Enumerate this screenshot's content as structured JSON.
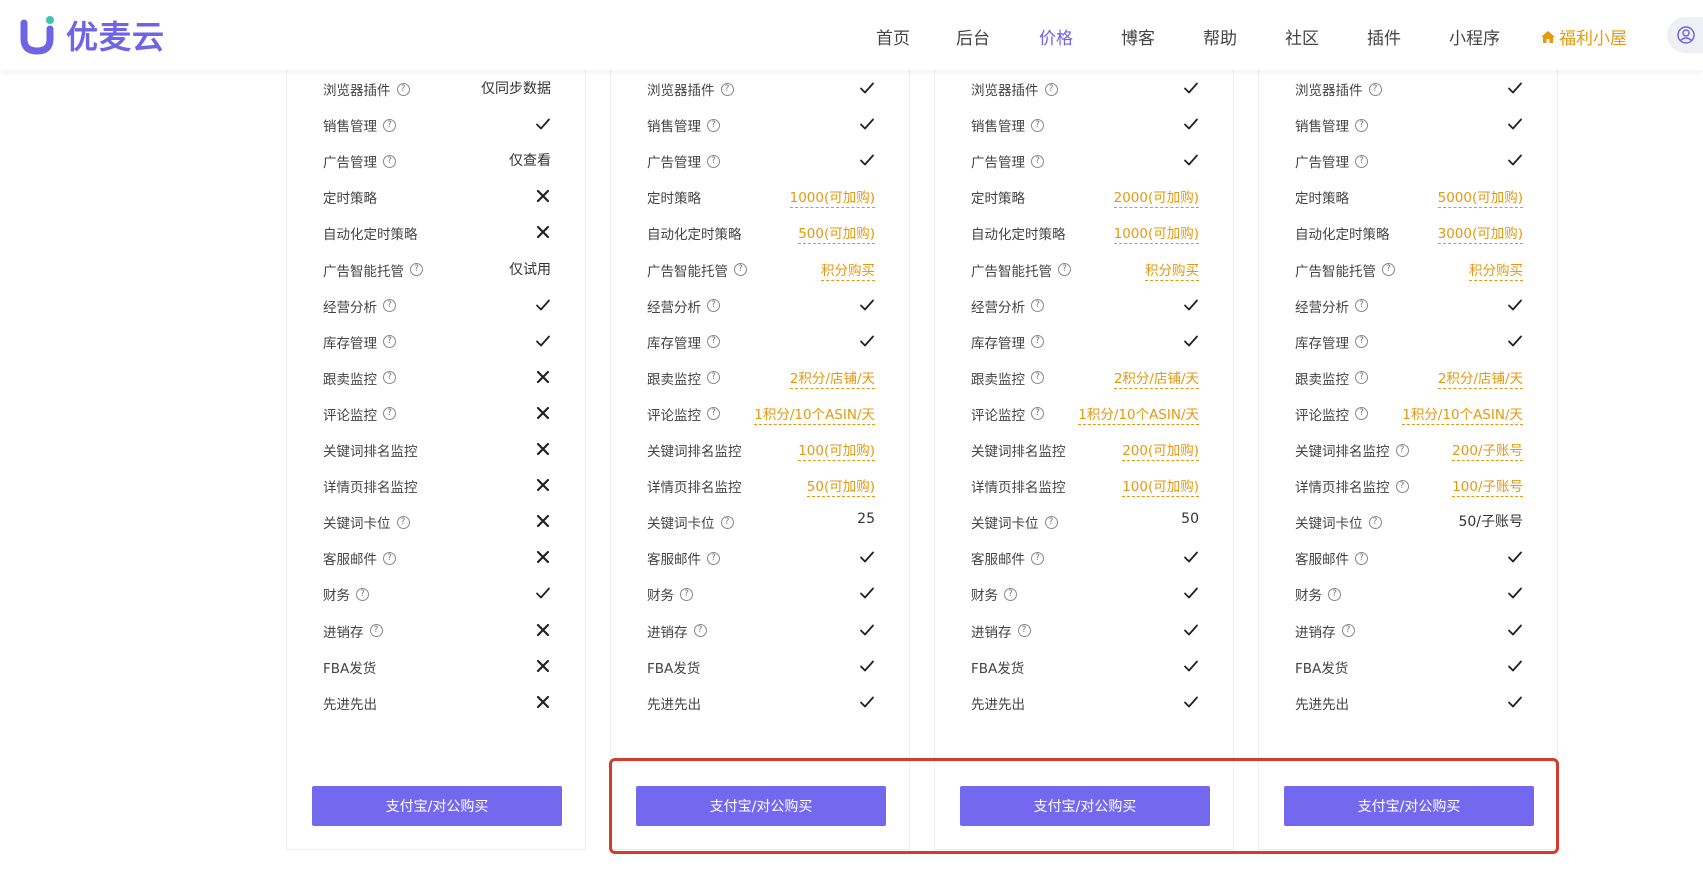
{
  "brand": {
    "name": "优麦云"
  },
  "nav": {
    "items": [
      "首页",
      "后台",
      "价格",
      "博客",
      "帮助",
      "社区",
      "插件",
      "小程序"
    ],
    "active_index": 2,
    "special": "福利小屋"
  },
  "colors": {
    "accent": "#7468ef",
    "orange": "#e39a10",
    "highlight": "#d23c2a"
  },
  "plans": [
    {
      "button": "支付宝/对公购买",
      "rows": [
        {
          "feature": "浏览器插件",
          "help": true,
          "kind": "text",
          "value": "仅同步数据"
        },
        {
          "feature": "销售管理",
          "help": true,
          "kind": "check"
        },
        {
          "feature": "广告管理",
          "help": true,
          "kind": "text",
          "value": "仅查看"
        },
        {
          "feature": "定时策略",
          "help": false,
          "kind": "cross"
        },
        {
          "feature": "自动化定时策略",
          "help": false,
          "kind": "cross"
        },
        {
          "feature": "广告智能托管",
          "help": true,
          "kind": "text",
          "value": "仅试用"
        },
        {
          "feature": "经营分析",
          "help": true,
          "kind": "check"
        },
        {
          "feature": "库存管理",
          "help": true,
          "kind": "check"
        },
        {
          "feature": "跟卖监控",
          "help": true,
          "kind": "cross"
        },
        {
          "feature": "评论监控",
          "help": true,
          "kind": "cross"
        },
        {
          "feature": "关键词排名监控",
          "help": false,
          "kind": "cross"
        },
        {
          "feature": "详情页排名监控",
          "help": false,
          "kind": "cross"
        },
        {
          "feature": "关键词卡位",
          "help": true,
          "kind": "cross"
        },
        {
          "feature": "客服邮件",
          "help": true,
          "kind": "cross"
        },
        {
          "feature": "财务",
          "help": true,
          "kind": "check"
        },
        {
          "feature": "进销存",
          "help": true,
          "kind": "cross"
        },
        {
          "feature": "FBA发货",
          "help": false,
          "kind": "cross"
        },
        {
          "feature": "先进先出",
          "help": false,
          "kind": "cross"
        }
      ]
    },
    {
      "button": "支付宝/对公购买",
      "rows": [
        {
          "feature": "浏览器插件",
          "help": true,
          "kind": "check"
        },
        {
          "feature": "销售管理",
          "help": true,
          "kind": "check"
        },
        {
          "feature": "广告管理",
          "help": true,
          "kind": "check"
        },
        {
          "feature": "定时策略",
          "help": false,
          "kind": "orange",
          "value": "1000(可加购)"
        },
        {
          "feature": "自动化定时策略",
          "help": false,
          "kind": "orange",
          "value": "500(可加购)"
        },
        {
          "feature": "广告智能托管",
          "help": true,
          "kind": "orange",
          "value": "积分购买"
        },
        {
          "feature": "经营分析",
          "help": true,
          "kind": "check"
        },
        {
          "feature": "库存管理",
          "help": true,
          "kind": "check"
        },
        {
          "feature": "跟卖监控",
          "help": true,
          "kind": "orange",
          "value": "2积分/店铺/天"
        },
        {
          "feature": "评论监控",
          "help": true,
          "kind": "orange",
          "value": "1积分/10个ASIN/天"
        },
        {
          "feature": "关键词排名监控",
          "help": false,
          "kind": "orange",
          "value": "100(可加购)"
        },
        {
          "feature": "详情页排名监控",
          "help": false,
          "kind": "orange",
          "value": "50(可加购)"
        },
        {
          "feature": "关键词卡位",
          "help": true,
          "kind": "text",
          "value": "25"
        },
        {
          "feature": "客服邮件",
          "help": true,
          "kind": "check"
        },
        {
          "feature": "财务",
          "help": true,
          "kind": "check"
        },
        {
          "feature": "进销存",
          "help": true,
          "kind": "check"
        },
        {
          "feature": "FBA发货",
          "help": false,
          "kind": "check"
        },
        {
          "feature": "先进先出",
          "help": false,
          "kind": "check"
        }
      ]
    },
    {
      "button": "支付宝/对公购买",
      "rows": [
        {
          "feature": "浏览器插件",
          "help": true,
          "kind": "check"
        },
        {
          "feature": "销售管理",
          "help": true,
          "kind": "check"
        },
        {
          "feature": "广告管理",
          "help": true,
          "kind": "check"
        },
        {
          "feature": "定时策略",
          "help": false,
          "kind": "orange",
          "value": "2000(可加购)"
        },
        {
          "feature": "自动化定时策略",
          "help": false,
          "kind": "orange",
          "value": "1000(可加购)"
        },
        {
          "feature": "广告智能托管",
          "help": true,
          "kind": "orange",
          "value": "积分购买"
        },
        {
          "feature": "经营分析",
          "help": true,
          "kind": "check"
        },
        {
          "feature": "库存管理",
          "help": true,
          "kind": "check"
        },
        {
          "feature": "跟卖监控",
          "help": true,
          "kind": "orange",
          "value": "2积分/店铺/天"
        },
        {
          "feature": "评论监控",
          "help": true,
          "kind": "orange",
          "value": "1积分/10个ASIN/天"
        },
        {
          "feature": "关键词排名监控",
          "help": false,
          "kind": "orange",
          "value": "200(可加购)"
        },
        {
          "feature": "详情页排名监控",
          "help": false,
          "kind": "orange",
          "value": "100(可加购)"
        },
        {
          "feature": "关键词卡位",
          "help": true,
          "kind": "text",
          "value": "50"
        },
        {
          "feature": "客服邮件",
          "help": true,
          "kind": "check"
        },
        {
          "feature": "财务",
          "help": true,
          "kind": "check"
        },
        {
          "feature": "进销存",
          "help": true,
          "kind": "check"
        },
        {
          "feature": "FBA发货",
          "help": false,
          "kind": "check"
        },
        {
          "feature": "先进先出",
          "help": false,
          "kind": "check"
        }
      ]
    },
    {
      "button": "支付宝/对公购买",
      "rows": [
        {
          "feature": "浏览器插件",
          "help": true,
          "kind": "check"
        },
        {
          "feature": "销售管理",
          "help": true,
          "kind": "check"
        },
        {
          "feature": "广告管理",
          "help": true,
          "kind": "check"
        },
        {
          "feature": "定时策略",
          "help": false,
          "kind": "orange",
          "value": "5000(可加购)"
        },
        {
          "feature": "自动化定时策略",
          "help": false,
          "kind": "orange",
          "value": "3000(可加购)"
        },
        {
          "feature": "广告智能托管",
          "help": true,
          "kind": "orange",
          "value": "积分购买"
        },
        {
          "feature": "经营分析",
          "help": true,
          "kind": "check"
        },
        {
          "feature": "库存管理",
          "help": true,
          "kind": "check"
        },
        {
          "feature": "跟卖监控",
          "help": true,
          "kind": "orange",
          "value": "2积分/店铺/天"
        },
        {
          "feature": "评论监控",
          "help": true,
          "kind": "orange",
          "value": "1积分/10个ASIN/天"
        },
        {
          "feature": "关键词排名监控",
          "help": true,
          "kind": "orange",
          "value": "200/子账号"
        },
        {
          "feature": "详情页排名监控",
          "help": true,
          "kind": "orange",
          "value": "100/子账号"
        },
        {
          "feature": "关键词卡位",
          "help": true,
          "kind": "text",
          "value": "50/子账号"
        },
        {
          "feature": "客服邮件",
          "help": true,
          "kind": "check"
        },
        {
          "feature": "财务",
          "help": true,
          "kind": "check"
        },
        {
          "feature": "进销存",
          "help": true,
          "kind": "check"
        },
        {
          "feature": "FBA发货",
          "help": false,
          "kind": "check"
        },
        {
          "feature": "先进先出",
          "help": false,
          "kind": "check"
        }
      ]
    }
  ]
}
